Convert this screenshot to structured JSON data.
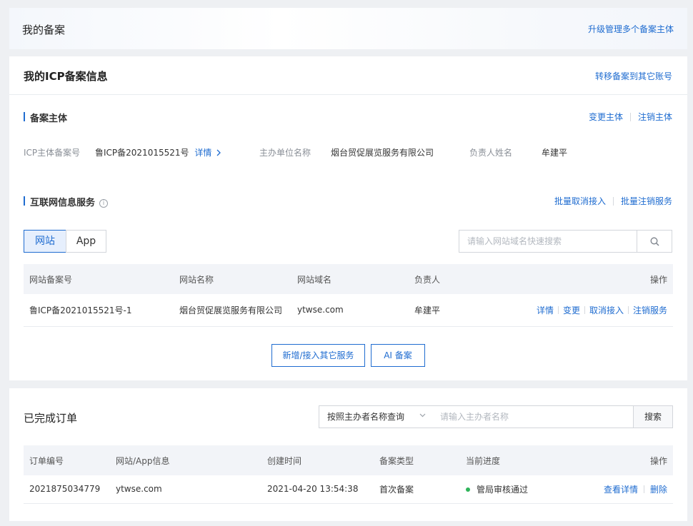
{
  "header": {
    "title": "我的备案",
    "upgrade_link": "升级管理多个备案主体"
  },
  "icp": {
    "title": "我的ICP备案信息",
    "transfer_link": "转移备案到其它账号",
    "subject": {
      "section_title": "备案主体",
      "change_link": "变更主体",
      "cancel_link": "注销主体",
      "record_no_label": "ICP主体备案号",
      "record_no_value": "鲁ICP备2021015521号",
      "detail_link": "详情",
      "org_label": "主办单位名称",
      "org_value": "烟台贸促展览服务有限公司",
      "owner_label": "负责人姓名",
      "owner_value": "牟建平"
    },
    "service": {
      "section_title": "互联网信息服务",
      "info_icon": "info-icon",
      "batch_cancel_access": "批量取消接入",
      "batch_cancel_service": "批量注销服务",
      "tabs": [
        "网站",
        "App"
      ],
      "active_tab": "网站",
      "search_placeholder": "请输入网站域名快速搜索",
      "table": {
        "headers": [
          "网站备案号",
          "网站名称",
          "网站域名",
          "负责人",
          "操作"
        ],
        "rows": [
          {
            "record_no": "鲁ICP备2021015521号-1",
            "name": "烟台贸促展览服务有限公司",
            "domain": "ytwse.com",
            "owner": "牟建平",
            "ops": [
              "详情",
              "变更",
              "取消接入",
              "注销服务"
            ]
          }
        ]
      },
      "add_button": "新增/接入其它服务",
      "ai_button": "AI 备案"
    }
  },
  "orders": {
    "title": "已完成订单",
    "query_select": "按照主办者名称查询",
    "query_placeholder": "请输入主办者名称",
    "search_button": "搜索",
    "table": {
      "headers": [
        "订单编号",
        "网站/App信息",
        "创建时间",
        "备案类型",
        "当前进度",
        "操作"
      ],
      "rows": [
        {
          "order_no": "2021875034779",
          "site": "ytwse.com",
          "created": "2021-04-20 13:54:38",
          "type": "首次备案",
          "progress": "管局审核通过",
          "progress_color": "#2fb45a",
          "ops": [
            "查看详情",
            "删除"
          ]
        }
      ]
    }
  },
  "colors": {
    "accent": "#1f6cd0",
    "background": "#eef0f3"
  }
}
